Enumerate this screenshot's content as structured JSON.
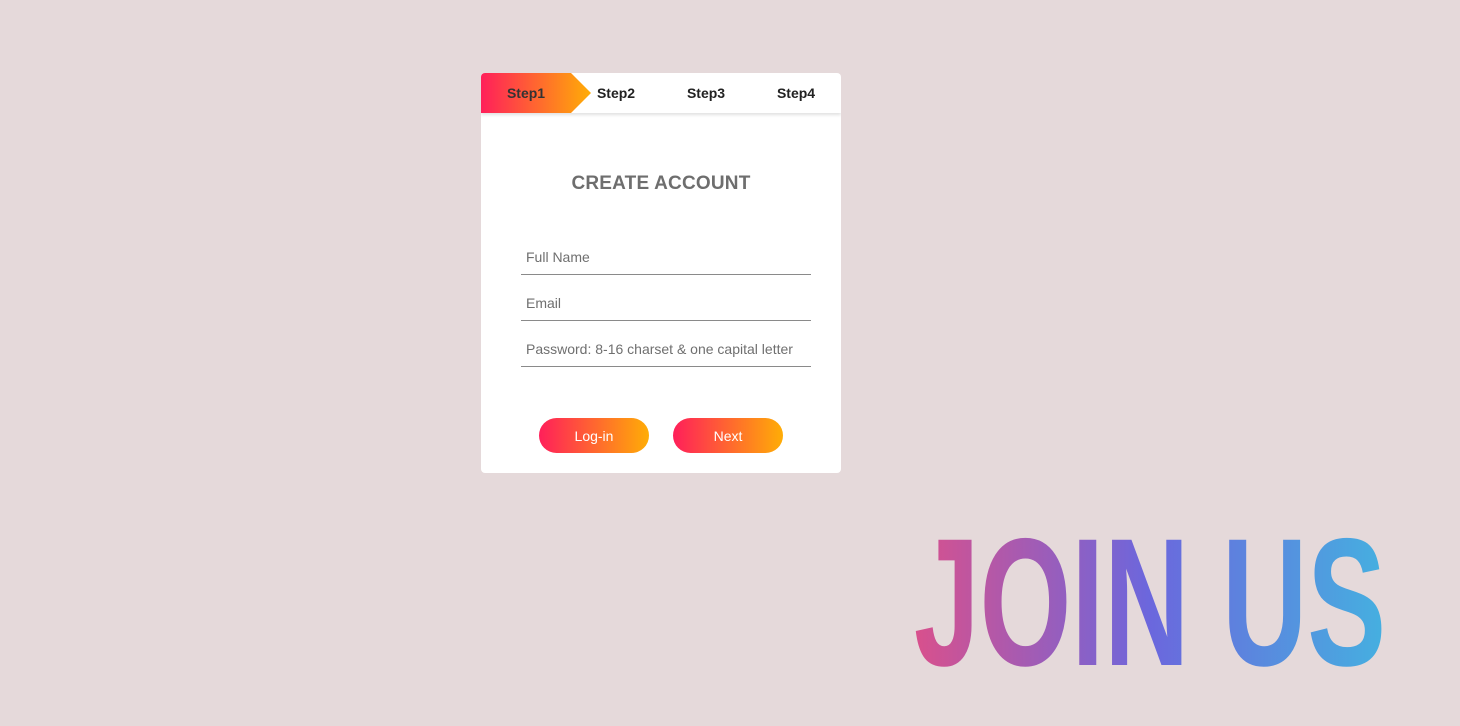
{
  "steps": [
    {
      "label": "Step1",
      "active": true
    },
    {
      "label": "Step2",
      "active": false
    },
    {
      "label": "Step3",
      "active": false
    },
    {
      "label": "Step4",
      "active": false
    }
  ],
  "form": {
    "title": "CREATE ACCOUNT",
    "full_name": {
      "value": "",
      "placeholder": "Full Name"
    },
    "email": {
      "value": "",
      "placeholder": "Email"
    },
    "password": {
      "value": "",
      "placeholder": "Password: 8-16 charset & one capital letter"
    }
  },
  "buttons": {
    "login_label": "Log-in",
    "next_label": "Next"
  },
  "banner": {
    "text": "JOIN US"
  },
  "colors": {
    "background": "#e5d9da",
    "gradient_start": "#ff1f5a",
    "gradient_end": "#ffad06",
    "banner_gradient": [
      "#d9508c",
      "#6b67dd",
      "#45b0e0"
    ]
  }
}
